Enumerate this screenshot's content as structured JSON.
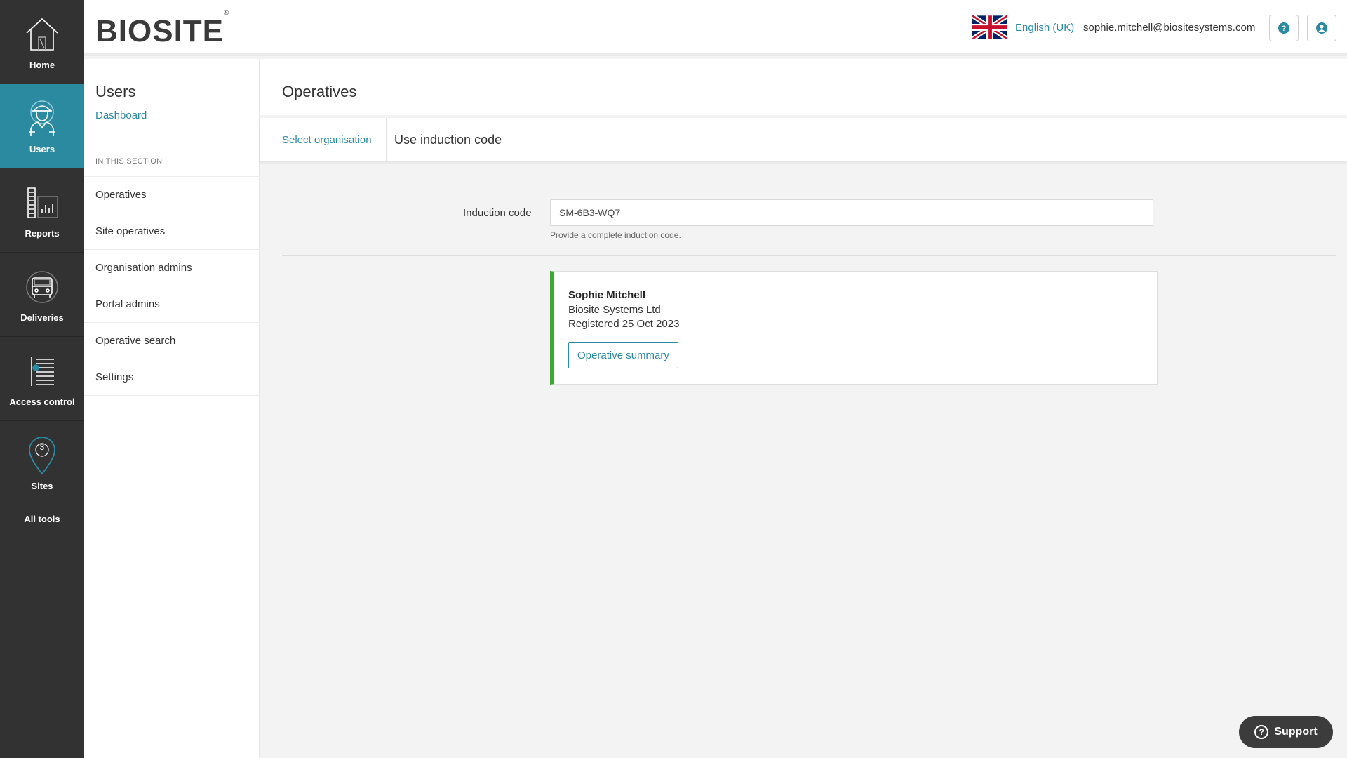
{
  "rail": {
    "items": [
      {
        "label": "Home",
        "icon": "home-icon"
      },
      {
        "label": "Users",
        "icon": "worker-icon"
      },
      {
        "label": "Reports",
        "icon": "reports-icon"
      },
      {
        "label": "Deliveries",
        "icon": "truck-icon"
      },
      {
        "label": "Access control",
        "icon": "turnstile-icon"
      },
      {
        "label": "Sites",
        "icon": "site-pin-icon",
        "badge": "3"
      }
    ],
    "all_tools": "All tools"
  },
  "header": {
    "logo": "BIOSITE",
    "logo_mark": "®",
    "language": "English (UK)",
    "user_email": "sophie.mitchell@biositesystems.com"
  },
  "sidebar": {
    "title": "Users",
    "dashboard_link": "Dashboard",
    "section_label": "IN THIS SECTION",
    "items": [
      {
        "label": "Operatives"
      },
      {
        "label": "Site operatives"
      },
      {
        "label": "Organisation admins"
      },
      {
        "label": "Portal admins"
      },
      {
        "label": "Operative search"
      },
      {
        "label": "Settings"
      }
    ]
  },
  "main": {
    "title": "Operatives",
    "tab_link": "Select organisation",
    "tab_current": "Use induction code",
    "form": {
      "label": "Induction code",
      "value": "SM-6B3-WQ7",
      "help": "Provide a complete induction code."
    },
    "result": {
      "name": "Sophie Mitchell",
      "organisation": "Biosite Systems Ltd",
      "registered": "Registered 25 Oct 2023",
      "button": "Operative summary"
    }
  },
  "support": {
    "label": "Support"
  },
  "colors": {
    "accent": "#2b8aa0",
    "rail_bg": "#323232",
    "success": "#3aaa35"
  }
}
